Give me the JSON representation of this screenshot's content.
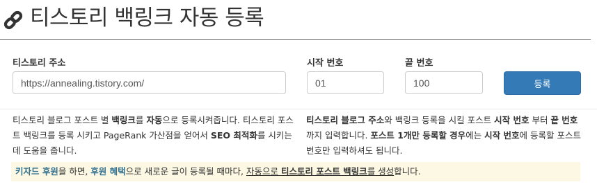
{
  "header": {
    "icon": "link-icon",
    "title": "티스토리 백링크 자동 등록"
  },
  "form": {
    "url_label": "티스토리 주소",
    "url_value": "https://annealing.tistory.com/",
    "start_label": "시작 번호",
    "start_value": "01",
    "end_label": "끝 번호",
    "end_value": "100",
    "submit_label": "등록"
  },
  "desc_left": {
    "t1": "티스토리 블로그 포스트 별 ",
    "b1": "백링크",
    "t2": "를 ",
    "b2": "자동",
    "t3": "으로 등록시켜줍니다. 티스토리 포스트 백링크를 등록 시키고 PageRank 가산점을 얻어서 ",
    "b3": "SEO 최적화",
    "t4": "를 시키는데 도움을 줍니다."
  },
  "desc_right": {
    "b1": "티스토리 블로그 주소",
    "t1": "와 백링크 등록을 시킬 포스트 ",
    "b2": "시작 번호",
    "t2": "부터 ",
    "b3": "끝 번호",
    "t3": "까지 입력합니다. ",
    "b4": "포스트 1개만 등록할 경우",
    "t4": "에는 ",
    "b5": "시작 번호",
    "t5": "에 등록할 포스트 번호만 입력하셔도 됩니다."
  },
  "notice": {
    "hl1": "키자드 후원",
    "t1": "을 하면, ",
    "hl2": "후원 혜택",
    "t2": "으로 새로운 글이 등록될 때마다, ",
    "u1": "자동으로 ",
    "u2": "티스토리 포스트 백링크",
    "u3": "를 생성",
    "t3": "합니다."
  },
  "colors": {
    "primary": "#337ab7",
    "notice_bg": "#fcf8e3",
    "notice_accent": "#31708f"
  }
}
